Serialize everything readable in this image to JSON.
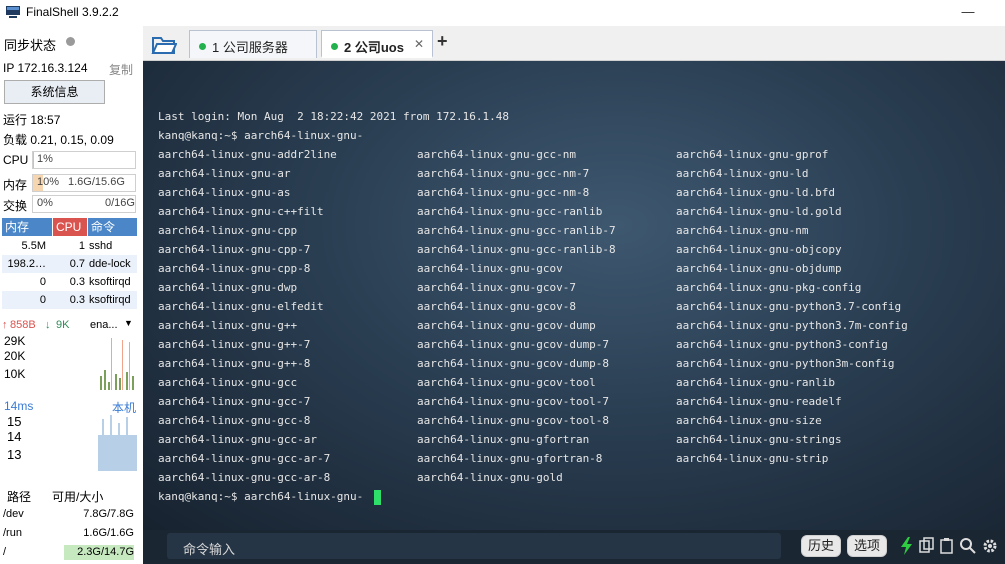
{
  "window": {
    "title": "FinalShell 3.9.2.2",
    "minimize": "—",
    "maximize": "☐"
  },
  "sidebar": {
    "sync_label": "同步状态",
    "ip": "IP 172.16.3.124",
    "copy_label": "复制",
    "sysinfo_label": "系统信息",
    "uptime": "运行 18:57",
    "load": "负载 0.21, 0.15, 0.09",
    "cpu": {
      "label": "CPU",
      "value": "1%",
      "fraction": 0.01
    },
    "mem": {
      "label": "内存",
      "percent": "10%",
      "value": "1.6G/15.6G",
      "fraction": 0.1
    },
    "swap": {
      "label": "交换",
      "percent": "0%",
      "value": "0/16G",
      "fraction": 0.0
    },
    "proc_headers": [
      "内存",
      "CPU",
      "命令"
    ],
    "processes": [
      {
        "mem": "5.5M",
        "cpu": "1",
        "cmd": "sshd"
      },
      {
        "mem": "198.2…",
        "cpu": "0.7",
        "cmd": "dde-lock"
      },
      {
        "mem": "0",
        "cpu": "0.3",
        "cmd": "ksoftirqd"
      },
      {
        "mem": "0",
        "cpu": "0.3",
        "cmd": "ksoftirqd"
      }
    ],
    "net": {
      "up": "858B",
      "down": "9K",
      "iface": "ena...",
      "ticks": [
        "29K",
        "20K",
        "10K"
      ]
    },
    "ping": {
      "latency": "14ms",
      "host": "本机",
      "ticks": [
        "15",
        "14",
        "13"
      ]
    },
    "disk_headers": [
      "路径",
      "可用/大小"
    ],
    "disks": [
      {
        "path": "/dev",
        "size": "7.8G/7.8G"
      },
      {
        "path": "/run",
        "size": "1.6G/1.6G"
      },
      {
        "path": "/",
        "size": "2.3G/14.7G"
      }
    ]
  },
  "tabs": [
    {
      "label": "1 公司服务器",
      "active": false
    },
    {
      "label": "2 公司uos",
      "active": true
    }
  ],
  "terminal": {
    "login": "Last login: Mon Aug  2 18:22:42 2021 from 172.16.1.48",
    "prompt": "kanq@kanq:~$ aarch64-linux-gnu-",
    "columns": [
      [
        "aarch64-linux-gnu-addr2line",
        "aarch64-linux-gnu-ar",
        "aarch64-linux-gnu-as",
        "aarch64-linux-gnu-c++filt",
        "aarch64-linux-gnu-cpp",
        "aarch64-linux-gnu-cpp-7",
        "aarch64-linux-gnu-cpp-8",
        "aarch64-linux-gnu-dwp",
        "aarch64-linux-gnu-elfedit",
        "aarch64-linux-gnu-g++",
        "aarch64-linux-gnu-g++-7",
        "aarch64-linux-gnu-g++-8",
        "aarch64-linux-gnu-gcc",
        "aarch64-linux-gnu-gcc-7",
        "aarch64-linux-gnu-gcc-8",
        "aarch64-linux-gnu-gcc-ar",
        "aarch64-linux-gnu-gcc-ar-7",
        "aarch64-linux-gnu-gcc-ar-8"
      ],
      [
        "aarch64-linux-gnu-gcc-nm",
        "aarch64-linux-gnu-gcc-nm-7",
        "aarch64-linux-gnu-gcc-nm-8",
        "aarch64-linux-gnu-gcc-ranlib",
        "aarch64-linux-gnu-gcc-ranlib-7",
        "aarch64-linux-gnu-gcc-ranlib-8",
        "aarch64-linux-gnu-gcov",
        "aarch64-linux-gnu-gcov-7",
        "aarch64-linux-gnu-gcov-8",
        "aarch64-linux-gnu-gcov-dump",
        "aarch64-linux-gnu-gcov-dump-7",
        "aarch64-linux-gnu-gcov-dump-8",
        "aarch64-linux-gnu-gcov-tool",
        "aarch64-linux-gnu-gcov-tool-7",
        "aarch64-linux-gnu-gcov-tool-8",
        "aarch64-linux-gnu-gfortran",
        "aarch64-linux-gnu-gfortran-8",
        "aarch64-linux-gnu-gold"
      ],
      [
        "aarch64-linux-gnu-gprof",
        "aarch64-linux-gnu-ld",
        "aarch64-linux-gnu-ld.bfd",
        "aarch64-linux-gnu-ld.gold",
        "aarch64-linux-gnu-nm",
        "aarch64-linux-gnu-objcopy",
        "aarch64-linux-gnu-objdump",
        "aarch64-linux-gnu-pkg-config",
        "aarch64-linux-gnu-python3.7-config",
        "aarch64-linux-gnu-python3.7m-config",
        "aarch64-linux-gnu-python3-config",
        "aarch64-linux-gnu-python3m-config",
        "aarch64-linux-gnu-ranlib",
        "aarch64-linux-gnu-readelf",
        "aarch64-linux-gnu-size",
        "aarch64-linux-gnu-strings",
        "aarch64-linux-gnu-strip"
      ]
    ]
  },
  "cmdbar": {
    "placeholder": "命令输入",
    "history": "历史",
    "options": "选项"
  },
  "colors": {
    "accent": "#2ee06a",
    "proc_header": "#4a86c8",
    "cpu_header": "#d9534f"
  }
}
